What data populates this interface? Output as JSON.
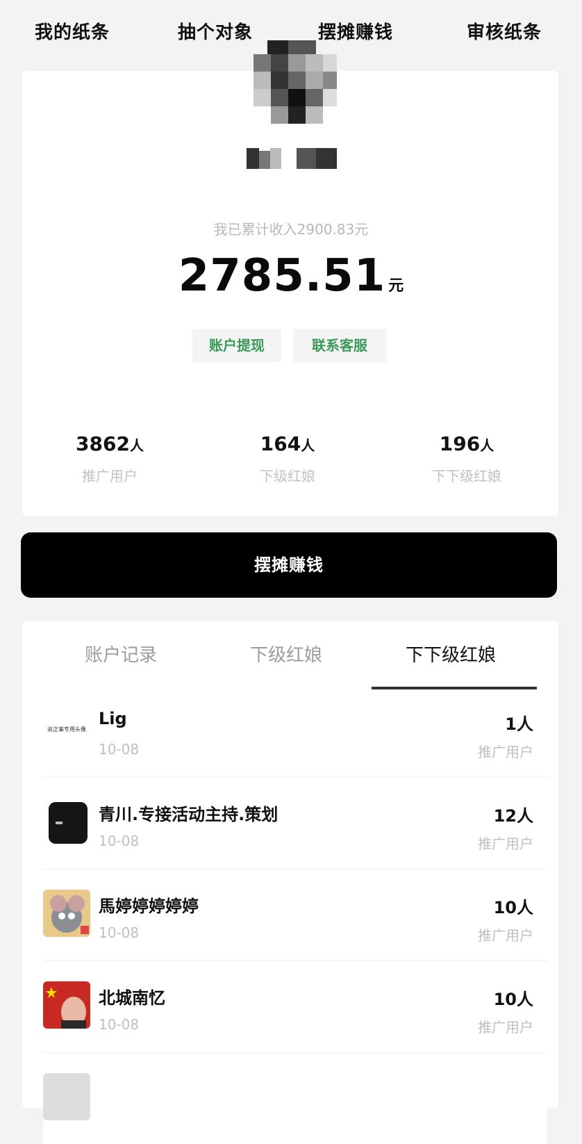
{
  "top_nav": {
    "items": [
      "我的纸条",
      "抽个对象",
      "摆摊赚钱",
      "审核纸条"
    ]
  },
  "profile": {
    "total_income_text": "我已累计收入2900.83元",
    "balance": "2785.51",
    "balance_unit": "元",
    "withdraw_label": "账户提现",
    "support_label": "联系客服",
    "stats": [
      {
        "value": "3862",
        "unit": "人",
        "label": "推广用户"
      },
      {
        "value": "164",
        "unit": "人",
        "label": "下级红娘"
      },
      {
        "value": "196",
        "unit": "人",
        "label": "下下级红娘"
      }
    ]
  },
  "main_button": {
    "label": "摆摊赚钱"
  },
  "tabs": [
    "账户记录",
    "下级红娘",
    "下下级红娘"
  ],
  "active_tab": "下下级红娘",
  "list": [
    {
      "name": "Lig",
      "date": "10-08",
      "count": "1人",
      "count_label": "推广用户",
      "avatar_text": "说正事专用头像"
    },
    {
      "name": "青川.专接活动主持.策划",
      "date": "10-08",
      "count": "12人",
      "count_label": "推广用户",
      "avatar_text": ""
    },
    {
      "name": "馬婷婷婷婷婷",
      "date": "10-08",
      "count": "10人",
      "count_label": "推广用户",
      "avatar_text": ""
    },
    {
      "name": "北城南忆",
      "date": "10-08",
      "count": "10人",
      "count_label": "推广用户",
      "avatar_text": ""
    }
  ],
  "colors": {
    "accent_green": "#3a9a57",
    "primary_black": "#000000"
  }
}
